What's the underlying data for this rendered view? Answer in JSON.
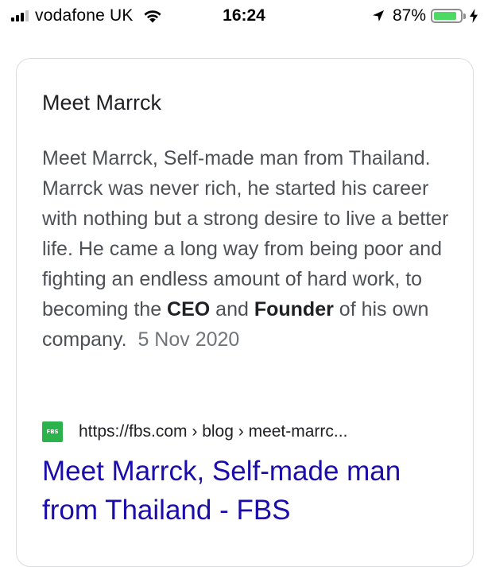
{
  "status_bar": {
    "carrier": "vodafone UK",
    "time": "16:24",
    "battery_percent": "87%",
    "battery_level": 0.87,
    "signal_bars": 3,
    "icons": [
      "signal-icon",
      "wifi-icon",
      "location-arrow-icon",
      "battery-icon",
      "charging-bolt-icon"
    ]
  },
  "result": {
    "card_title": "Meet Marrck",
    "snippet_parts": {
      "p1": "Meet Marrck, Self-made man from Thailand. Marrck was never rich, he started his career with nothing but a strong desire to live a better life. He came a long way from being poor and fighting an endless amount of hard work, to becoming the ",
      "bold1": "CEO",
      "p2": " and ",
      "bold2": "Founder",
      "p3": " of his own company."
    },
    "date": "5 Nov 2020",
    "favicon_text": "FBS",
    "source_url": "https://fbs.com › blog › meet-marrc...",
    "link_title": "Meet Marrck, Self-made man from Thailand - FBS"
  },
  "colors": {
    "link": "#1a0dab",
    "snippet": "#4d5156",
    "favicon_bg": "#2bb24c",
    "battery_fill": "#4cd964"
  }
}
